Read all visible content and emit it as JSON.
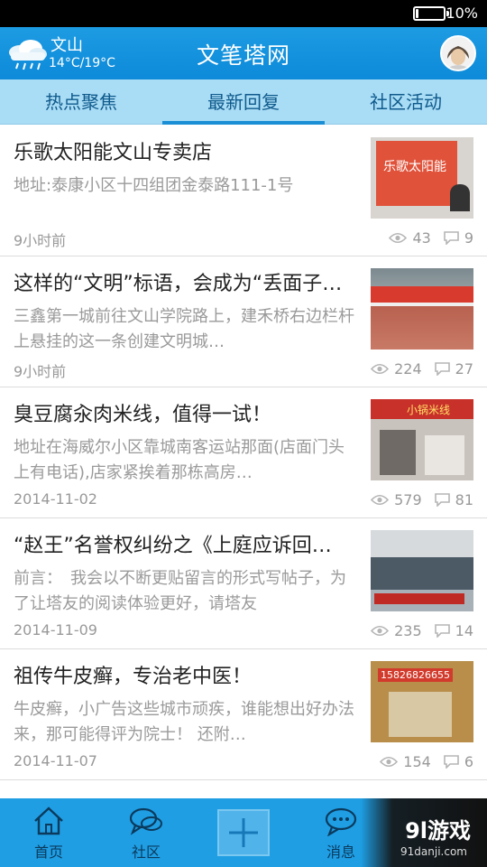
{
  "status_bar": {
    "battery": "10%",
    "battery_level": 0.1
  },
  "header": {
    "city": "文山",
    "temperature": "14°C/19°C",
    "title": "文笔塔网"
  },
  "tabs": [
    {
      "label": "热点聚焦",
      "active": false
    },
    {
      "label": "最新回复",
      "active": true
    },
    {
      "label": "社区活动",
      "active": false
    }
  ],
  "posts": [
    {
      "title": "乐歌太阳能文山专卖店",
      "excerpt": "地址:泰康小区十四组团金泰路111-1号",
      "time": "9小时前",
      "views": "43",
      "comments": "9",
      "thumb_text": "乐歌太阳能"
    },
    {
      "title": "这样的“文明”标语，会成为“丢面子…",
      "excerpt": "三鑫第一城前往文山学院路上，建禾桥右边栏杆上悬挂的这一条创建文明城…",
      "time": "9小时前",
      "views": "224",
      "comments": "27",
      "thumb_text": ""
    },
    {
      "title": "臭豆腐汆肉米线，值得一试！",
      "excerpt": "地址在海威尔小区靠城南客运站那面(店面门头上有电话),店家紧挨着那栋高房…",
      "time": "2014-11-02",
      "views": "579",
      "comments": "81",
      "thumb_text": "小锅米线"
    },
    {
      "title": "“赵王”名誉权纠纷之《上庭应诉回…",
      "excerpt": "前言：　我会以不断更贴留言的形式写帖子，为了让塔友的阅读体验更好，请塔友",
      "time": "2014-11-09",
      "views": "235",
      "comments": "14",
      "thumb_text": ""
    },
    {
      "title": "祖传牛皮癣，专治老中医！",
      "excerpt": "牛皮癣，小广告这些城市顽疾，谁能想出好办法来，那可能得评为院士！ 还附…",
      "time": "2014-11-07",
      "views": "154",
      "comments": "6",
      "thumb_text": "15826826655"
    }
  ],
  "bottom_nav": [
    {
      "label": "首页",
      "icon": "home-icon"
    },
    {
      "label": "社区",
      "icon": "chat-bubbles-icon"
    },
    {
      "label": "",
      "icon": "plus-icon"
    },
    {
      "label": "消息",
      "icon": "message-icon"
    }
  ],
  "watermark": {
    "logo": "9l游戏",
    "url": "91danji.com"
  },
  "colors": {
    "header": "#1d9be2",
    "tab_bar": "#a9dcf5",
    "bottom_nav": "#1f9ee4"
  }
}
